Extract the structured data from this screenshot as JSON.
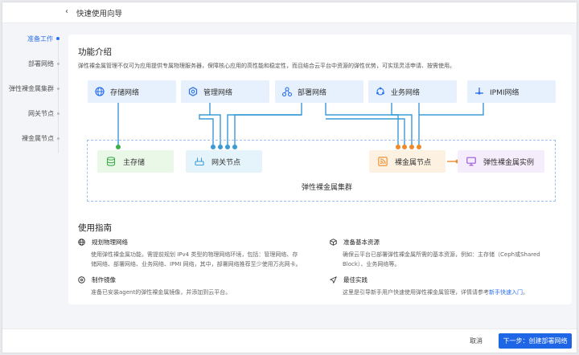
{
  "header": {
    "title": "快速使用向导"
  },
  "steps": [
    {
      "label": "准备工作",
      "active": true
    },
    {
      "label": "部署网络",
      "active": false
    },
    {
      "label": "弹性裸金属集群",
      "active": false
    },
    {
      "label": "网关节点",
      "active": false
    },
    {
      "label": "裸金属节点",
      "active": false
    }
  ],
  "intro": {
    "title": "功能介绍",
    "description": "弹性裸金属管理不仅可为应用提供专属物理服务器，保障核心应用的高性能和稳定性，而且结合云平台中资源的弹性优势，可实现灵活申请、按需使用。"
  },
  "networks": [
    {
      "label": "存储网络",
      "icon": "globe-icon"
    },
    {
      "label": "管理网络",
      "icon": "hexagon-gear-icon"
    },
    {
      "label": "部署网络",
      "icon": "deploy-nodes-icon"
    },
    {
      "label": "业务网络",
      "icon": "cycle-nodes-icon"
    },
    {
      "label": "IPMI网络",
      "icon": "ipmi-network-icon"
    }
  ],
  "cluster": {
    "label": "弹性裸金属集群",
    "nodes": {
      "storage": "主存储",
      "gateway": "网关节点",
      "baremetal": "裸金属节点",
      "instance": "弹性裸金属实例"
    }
  },
  "guide": {
    "title": "使用指南",
    "items": [
      {
        "title": "规划物理网络",
        "icon": "globe-icon",
        "body": "使用弹性裸金属功能，需提前规划 IPv4 类型的物理网络环境，包括：管理网络、存储网络、部署网络、业务网络、IPMI 网络，其中，部署网络推荐至少使用万兆网卡。"
      },
      {
        "title": "准备基本资源",
        "icon": "cube-icon",
        "body": "确保云平台已部署弹性裸金属所需的基本资源，例如：主存储（Ceph或Shared Block）、业务网络等。"
      },
      {
        "title": "制作镜像",
        "icon": "disc-icon",
        "body": "准备已安装agent的弹性裸金属镜像，并添加到云平台。"
      },
      {
        "title": "最佳实践",
        "icon": "send-icon",
        "body": "这里是引导新手用户快速使用弹性裸金属管理，详情请参考",
        "link": "新手快速入门",
        "suffix": "。"
      }
    ]
  },
  "footer": {
    "cancel": "取消",
    "next": "下一步：创建部署网络"
  },
  "colors": {
    "primary": "#1f66e6",
    "network_bg": "#e6f1fd",
    "storage_bg": "#eaf8e8",
    "gateway_bg": "#e5f4fb",
    "baremetal_bg": "#fdf1e1",
    "instance_bg": "#f5ecfc",
    "wire_blue": "#3a9bd5",
    "wire_orange": "#ef8a2a"
  }
}
